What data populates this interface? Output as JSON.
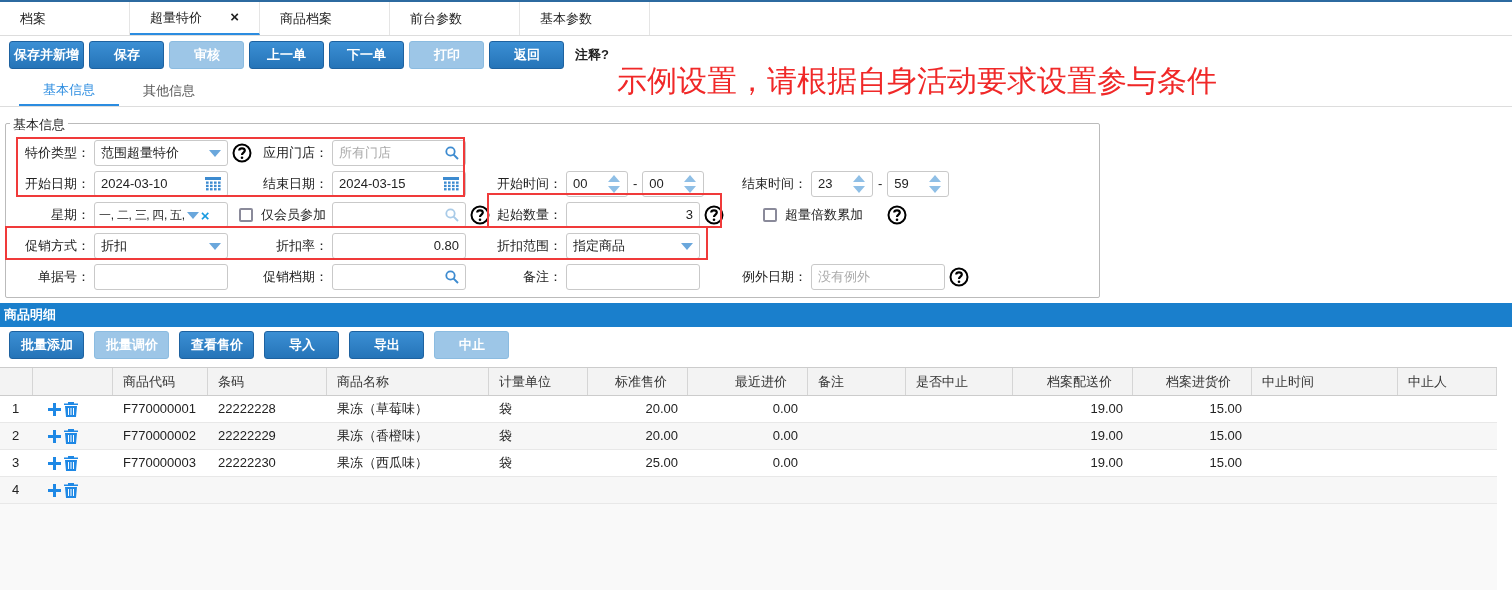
{
  "tabs": [
    {
      "label": "档案",
      "selected": false
    },
    {
      "label": "超量特价",
      "selected": true,
      "close": "×"
    },
    {
      "label": "商品档案",
      "selected": false
    },
    {
      "label": "前台参数",
      "selected": false
    },
    {
      "label": "基本参数",
      "selected": false
    }
  ],
  "toolbar": {
    "buttons": [
      {
        "label": "保存并新增",
        "disabled": false
      },
      {
        "label": "保存",
        "disabled": false
      },
      {
        "label": "审核",
        "disabled": true
      },
      {
        "label": "上一单",
        "disabled": false
      },
      {
        "label": "下一单",
        "disabled": false
      },
      {
        "label": "打印",
        "disabled": true
      },
      {
        "label": "返回",
        "disabled": false
      }
    ],
    "note": "注释?"
  },
  "annotation": "示例设置，请根据自身活动要求设置参与条件",
  "subtabs": [
    {
      "label": "基本信息",
      "selected": true
    },
    {
      "label": "其他信息",
      "selected": false
    }
  ],
  "form": {
    "legend": "基本信息",
    "rows": [
      [
        {
          "kind": "select",
          "label": "特价类型：",
          "value": "范围超量特价",
          "help": true
        },
        {
          "kind": "search",
          "label": "应用门店：",
          "placeholder": "所有门店"
        }
      ],
      [
        {
          "kind": "date",
          "label": "开始日期：",
          "value": "2024-03-10"
        },
        {
          "kind": "date",
          "label": "结束日期：",
          "value": "2024-03-15"
        },
        {
          "kind": "time",
          "label": "开始时间：",
          "hour": "00",
          "sep": "-",
          "minute": "00"
        },
        {
          "kind": "time",
          "label": "结束时间：",
          "hour": "23",
          "sep": "-",
          "minute": "59"
        }
      ],
      [
        {
          "kind": "multiselect",
          "label": "星期：",
          "value": "一, 二, 三, 四, 五,",
          "clear": "×"
        },
        {
          "kind": "search",
          "checkbox": {
            "label": "仅会员参加",
            "checked": false
          },
          "help": true
        },
        {
          "kind": "number",
          "label": "起始数量：",
          "value": "3",
          "help": true
        },
        {
          "kind": "checkbox",
          "label": "超量倍数累加",
          "checked": false,
          "help": true
        }
      ],
      [
        {
          "kind": "select",
          "label": "促销方式：",
          "value": "折扣"
        },
        {
          "kind": "number",
          "label": "折扣率：",
          "value": "0.80"
        },
        {
          "kind": "select",
          "label": "折扣范围：",
          "value": "指定商品"
        }
      ],
      [
        {
          "kind": "text",
          "label": "单据号："
        },
        {
          "kind": "search",
          "label": "促销档期："
        },
        {
          "kind": "text",
          "label": "备注："
        },
        {
          "kind": "text",
          "label": "例外日期：",
          "placeholder": "没有例外",
          "help": true
        }
      ]
    ]
  },
  "detail": {
    "title": "商品明细",
    "buttons": [
      {
        "label": "批量添加",
        "disabled": false
      },
      {
        "label": "批量调价",
        "disabled": true
      },
      {
        "label": "查看售价",
        "disabled": false
      },
      {
        "label": "导入",
        "disabled": false
      },
      {
        "label": "导出",
        "disabled": false
      },
      {
        "label": "中止",
        "disabled": true
      }
    ],
    "columns": [
      "商品代码",
      "条码",
      "商品名称",
      "计量单位",
      "标准售价",
      "最近进价",
      "备注",
      "是否中止",
      "档案配送价",
      "档案进货价",
      "中止时间",
      "中止人"
    ],
    "rows": [
      {
        "index": "1",
        "cells": [
          "F770000001",
          "22222228",
          "果冻（草莓味）",
          "袋",
          "20.00",
          "0.00",
          "",
          "",
          "19.00",
          "15.00",
          "",
          ""
        ]
      },
      {
        "index": "2",
        "cells": [
          "F770000002",
          "22222229",
          "果冻（香橙味）",
          "袋",
          "20.00",
          "0.00",
          "",
          "",
          "19.00",
          "15.00",
          "",
          ""
        ]
      },
      {
        "index": "3",
        "cells": [
          "F770000003",
          "22222230",
          "果冻（西瓜味）",
          "袋",
          "25.00",
          "0.00",
          "",
          "",
          "19.00",
          "15.00",
          "",
          ""
        ]
      },
      {
        "index": "4"
      }
    ]
  }
}
